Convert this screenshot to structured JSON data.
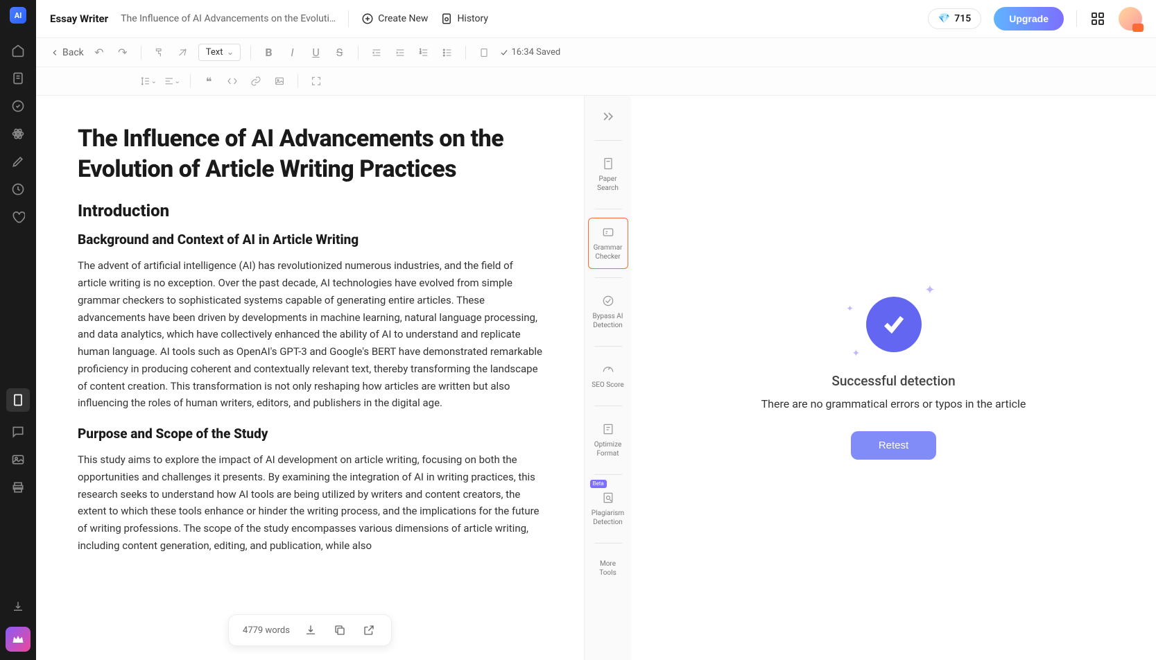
{
  "header": {
    "app_title": "Essay Writer",
    "doc_title": "The Influence of AI Advancements on the Evoluti…",
    "create_new": "Create New",
    "history": "History",
    "credits": "715",
    "upgrade": "Upgrade"
  },
  "toolbar": {
    "back": "Back",
    "text_select": "Text",
    "saved": "16:34 Saved"
  },
  "document": {
    "title": "The Influence of AI Advancements on the Evolution of Article Writing Practices",
    "h2_intro": "Introduction",
    "h3_background": "Background and Context of AI in Article Writing",
    "p_background": "The advent of artificial intelligence (AI) has revolutionized numerous industries, and the field of article writing is no exception. Over the past decade, AI technologies have evolved from simple grammar checkers to sophisticated systems capable of generating entire articles. These advancements have been driven by developments in machine learning, natural language processing, and data analytics, which have collectively enhanced the ability of AI to understand and replicate human language. AI tools such as OpenAI's GPT-3 and Google's BERT have demonstrated remarkable proficiency in producing coherent and contextually relevant text, thereby transforming the landscape of content creation. This transformation is not only reshaping how articles are written but also influencing the roles of human writers, editors, and publishers in the digital age.",
    "h3_purpose": "Purpose and Scope of the Study",
    "p_purpose": "This study aims to explore the impact of AI development on article writing, focusing on both the opportunities and challenges it presents. By examining the integration of AI in writing practices, this research seeks to understand how AI tools are being utilized by writers and content creators, the extent to which these tools enhance or hinder the writing process, and the implications for the future of writing professions. The scope of the study encompasses various dimensions of article writing, including content generation, editing, and publication, while also"
  },
  "footer": {
    "word_count": "4779 words"
  },
  "tool_strip": {
    "paper_search": "Paper Search",
    "grammar_checker": "Grammar Checker",
    "bypass_ai": "Bypass AI Detection",
    "seo_score": "SEO Score",
    "optimize_format": "Optimize Format",
    "plagiarism": "Plagiarism Detection",
    "more_tools": "More Tools",
    "beta": "Beta"
  },
  "right_panel": {
    "success_title": "Successful detection",
    "success_msg": "There are no grammatical errors or typos in the article",
    "retest": "Retest"
  }
}
